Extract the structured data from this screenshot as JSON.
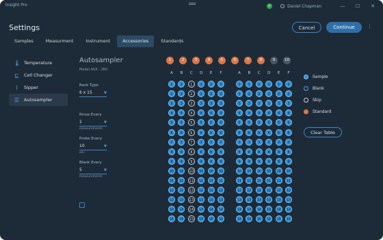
{
  "app": {
    "title": "Insight Pro",
    "user": "Daniel Chapman",
    "status_icon": "check-circle-icon"
  },
  "header": {
    "title": "Settings",
    "cancel_label": "Cancel",
    "continue_label": "Continue",
    "more_label": "⋮"
  },
  "tabs": [
    {
      "label": "Samples",
      "active": false
    },
    {
      "label": "Measurment",
      "active": false
    },
    {
      "label": "Instrument",
      "active": false
    },
    {
      "label": "Accessories",
      "active": true
    },
    {
      "label": "Standards",
      "active": false
    }
  ],
  "sidebar": {
    "items": [
      {
        "label": "Temperature",
        "icon": "thermometer-icon",
        "glyph": "🌡",
        "active": false
      },
      {
        "label": "Cell Changer",
        "icon": "cell-changer-icon",
        "glyph": "⊑",
        "active": false
      },
      {
        "label": "Sipper",
        "icon": "sipper-icon",
        "glyph": "⌇",
        "active": false
      },
      {
        "label": "Autosampler",
        "icon": "autosampler-icon",
        "glyph": "☰",
        "active": true
      }
    ]
  },
  "autosampler": {
    "title": "Autosampler",
    "model": "Model ASX - 260",
    "rack_type": {
      "label": "Rack Type",
      "value": "6 x 15"
    },
    "rinse": {
      "label": "Rinse Every",
      "value": "1",
      "unit": "measurements"
    },
    "probe": {
      "label": "Probe Every",
      "value": "10",
      "unit": "sec"
    },
    "blank": {
      "label": "Blank Every",
      "value": "5",
      "unit": "measurements"
    }
  },
  "standards_row": [
    {
      "n": "1",
      "state": "standard"
    },
    {
      "n": "2",
      "state": "standard"
    },
    {
      "n": "3",
      "state": "standard"
    },
    {
      "n": "4",
      "state": "standard"
    },
    {
      "n": "5",
      "state": "standard"
    },
    {
      "n": "6",
      "state": "standard"
    },
    {
      "n": "7",
      "state": "standard"
    },
    {
      "n": "8",
      "state": "standard"
    },
    {
      "n": "9",
      "state": "skip"
    },
    {
      "n": "10",
      "state": "skip"
    }
  ],
  "rack": {
    "columns": [
      "A",
      "B",
      "C",
      "D",
      "E",
      "F"
    ],
    "rows": 15,
    "left_blank_columns": [
      "C"
    ],
    "right_blank_columns": []
  },
  "legend": [
    {
      "label": "Sample",
      "color": "#2b8ed8",
      "style": "filled"
    },
    {
      "label": "Blank",
      "color": "#4ea3e8",
      "style": "outline"
    },
    {
      "label": "Skip",
      "color": "#cfd8e0",
      "style": "outline"
    },
    {
      "label": "Standard",
      "color": "#d9774a",
      "style": "filled"
    }
  ],
  "clear_label": "Clear Table",
  "colors": {
    "accent": "#2b8ed8",
    "standard": "#d9774a",
    "skip": "#4a5866",
    "background": "#1d2b38"
  }
}
